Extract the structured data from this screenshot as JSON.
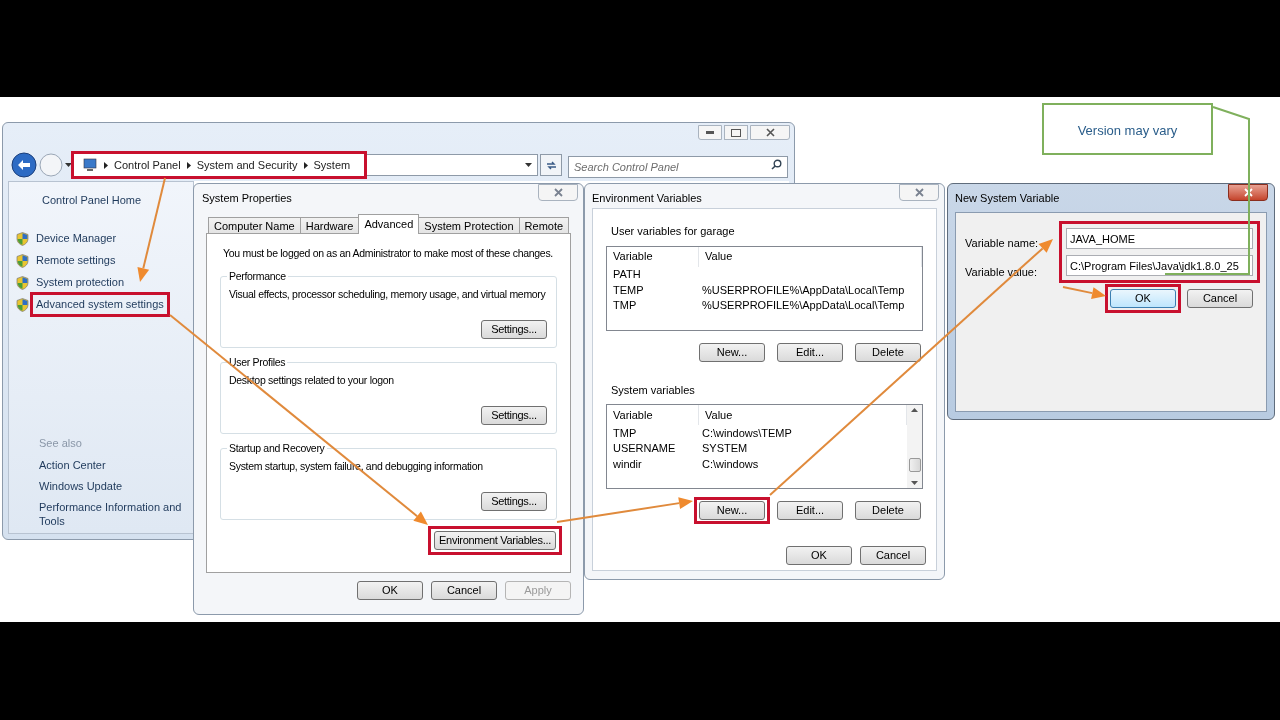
{
  "control_panel": {
    "breadcrumb": [
      "Control Panel",
      "System and Security",
      "System"
    ],
    "breadcrumb_highlighted": true,
    "search": {
      "placeholder": "Search Control Panel"
    },
    "sidebar": {
      "home": "Control Panel Home",
      "items": [
        {
          "label": "Device Manager",
          "highlighted": false
        },
        {
          "label": "Remote settings",
          "highlighted": false
        },
        {
          "label": "System protection",
          "highlighted": false
        },
        {
          "label": "Advanced system settings",
          "highlighted": true
        }
      ],
      "see_also_heading": "See also",
      "see_also": [
        "Action Center",
        "Windows Update",
        "Performance Information and Tools"
      ]
    }
  },
  "system_properties": {
    "title": "System Properties",
    "tabs": [
      {
        "label": "Computer Name",
        "selected": false
      },
      {
        "label": "Hardware",
        "selected": false
      },
      {
        "label": "Advanced",
        "selected": true
      },
      {
        "label": "System Protection",
        "selected": false
      },
      {
        "label": "Remote",
        "selected": false
      }
    ],
    "notice": "You must be logged on as an Administrator to make most of these changes.",
    "groups": [
      {
        "title": "Performance",
        "description": "Visual effects, processor scheduling, memory usage, and virtual memory",
        "button": "Settings..."
      },
      {
        "title": "User Profiles",
        "description": "Desktop settings related to your logon",
        "button": "Settings..."
      },
      {
        "title": "Startup and Recovery",
        "description": "System startup, system failure, and debugging information",
        "button": "Settings..."
      }
    ],
    "env_button": {
      "label": "Environment Variables...",
      "highlighted": true
    },
    "buttons": [
      {
        "label": "OK",
        "disabled": false
      },
      {
        "label": "Cancel",
        "disabled": false
      },
      {
        "label": "Apply",
        "disabled": true
      }
    ]
  },
  "environment_variables": {
    "title": "Environment Variables",
    "sections": [
      {
        "title": "User variables for garage",
        "columns": [
          "Variable",
          "Value"
        ],
        "scrollbar": false,
        "rows": [
          {
            "variable": "PATH"
          },
          {
            "variable": "TEMP",
            "value": "%USERPROFILE%\\AppData\\Local\\Temp"
          },
          {
            "variable": "TMP",
            "value": "%USERPROFILE%\\AppData\\Local\\Temp"
          }
        ],
        "buttons": [
          {
            "label": "New...",
            "highlighted": false
          },
          {
            "label": "Edit...",
            "highlighted": false
          },
          {
            "label": "Delete",
            "highlighted": false
          }
        ]
      },
      {
        "title": "System variables",
        "columns": [
          "Variable",
          "Value"
        ],
        "scrollbar": true,
        "rows": [
          {
            "variable": "TMP",
            "value": "C:\\windows\\TEMP"
          },
          {
            "variable": "USERNAME",
            "value": "SYSTEM"
          },
          {
            "variable": "windir",
            "value": "C:\\windows"
          }
        ],
        "buttons": [
          {
            "label": "New...",
            "highlighted": true
          },
          {
            "label": "Edit...",
            "highlighted": false
          },
          {
            "label": "Delete",
            "highlighted": false
          }
        ]
      }
    ],
    "buttons": [
      "OK",
      "Cancel"
    ]
  },
  "new_system_variable": {
    "title": "New System Variable",
    "fields_highlighted": true,
    "fields": [
      {
        "label": "Variable name:",
        "value": "JAVA_HOME"
      },
      {
        "label": "Variable value:",
        "value": "C:\\Program Files\\Java\\jdk1.8.0_25"
      }
    ],
    "buttons": [
      {
        "label": "OK",
        "default": true,
        "highlighted": true
      },
      {
        "label": "Cancel",
        "default": false,
        "highlighted": false
      }
    ]
  },
  "annotation": {
    "text": "Version may vary"
  }
}
